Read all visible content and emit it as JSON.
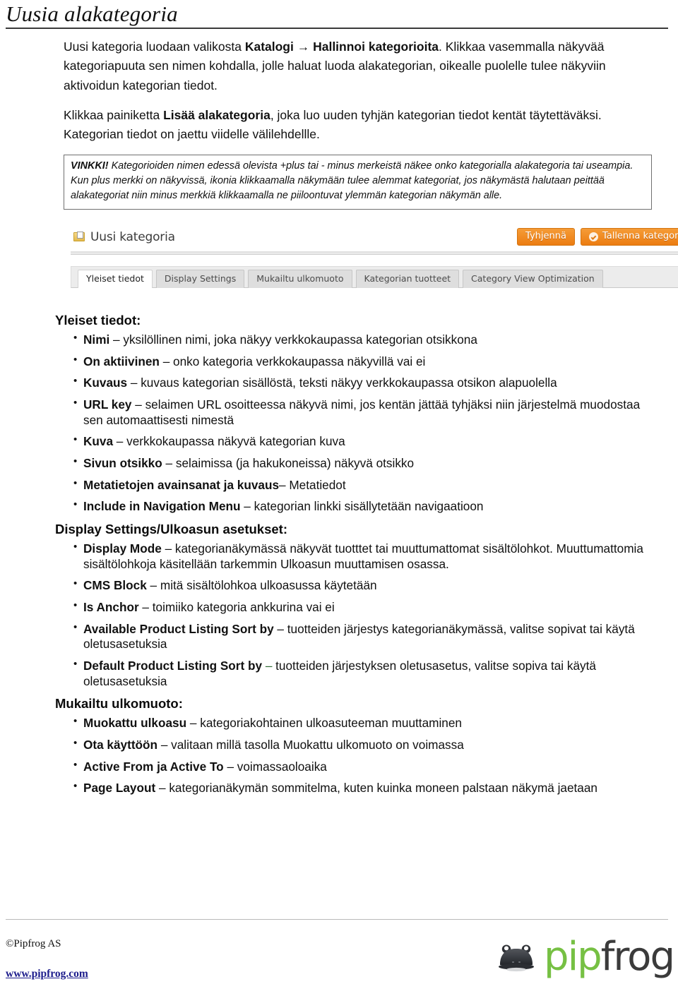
{
  "document": {
    "title": "Uusia alakategoria"
  },
  "intro": {
    "p1_a": "Uusi kategoria luodaan valikosta ",
    "p1_b": "Katalogi → Hallinnoi kategorioita",
    "p1_c": ". Klikkaa vasemmalla näkyvää kategoriapuuta sen nimen kohdalla, jolle haluat luoda alakategorian, oikealle puolelle tulee näkyviin aktivoidun kategorian tiedot.",
    "p2_a": "Klikkaa painiketta ",
    "p2_b": "Lisää alakategoria",
    "p2_c": ", joka luo uuden tyhjän kategorian tiedot kentät täytettäväksi. Kategorian tiedot on jaettu viidelle välilehdellle."
  },
  "tip": {
    "heading": "VINKKI!",
    "body": " Kategorioiden nimen edessä olevista +plus tai - minus merkeistä näkee onko kategorialla alakategoria tai useampia. Kun plus merkki on näkyvissä, ikonia klikkaamalla näkymään tulee alemmat kategoriat, jos näkymästä halutaan peittää alakategoriat niin minus merkkiä klikkaamalla ne piiloontuvat ylemmän kategorian näkymän alle."
  },
  "panel": {
    "icon": "folder-page-icon",
    "title": "Uusi kategoria",
    "buttons": [
      {
        "label": "Tyhjennä",
        "icon": null,
        "color": "#ec7c11"
      },
      {
        "label": "Tallenna kategoria",
        "icon": "check-circle-icon",
        "color": "#ec7c11"
      }
    ],
    "tabs": [
      {
        "label": "Yleiset tiedot",
        "active": true
      },
      {
        "label": "Display Settings",
        "active": false
      },
      {
        "label": "Mukailtu ulkomuoto",
        "active": false
      },
      {
        "label": "Kategorian tuotteet",
        "active": false
      },
      {
        "label": "Category View Optimization",
        "active": false
      }
    ]
  },
  "sections": [
    {
      "heading": "Yleiset tiedot:",
      "items": [
        {
          "term": "Nimi",
          "sep": " – ",
          "desc": "yksilöllinen nimi, joka näkyy verkkokaupassa kategorian otsikkona"
        },
        {
          "term": "On aktiivinen",
          "sep": " – ",
          "desc": "onko kategoria verkkokaupassa näkyvillä vai ei"
        },
        {
          "term": "Kuvaus",
          "sep": " – ",
          "desc": "kuvaus kategorian sisällöstä, teksti näkyy verkkokaupassa otsikon alapuolella"
        },
        {
          "term": "URL key",
          "sep": " – ",
          "desc": "selaimen URL osoitteessa näkyvä nimi, jos kentän jättää tyhjäksi niin järjestelmä muodostaa sen automaattisesti nimestä"
        },
        {
          "term": "Kuva",
          "sep": " – ",
          "desc": "verkkokaupassa näkyvä kategorian kuva"
        },
        {
          "term": "Sivun otsikko",
          "sep": " – ",
          "desc": "selaimissa (ja hakukoneissa) näkyvä otsikko"
        },
        {
          "term": "Metatietojen avainsanat ja kuvaus",
          "sep": "– ",
          "desc": "Metatiedot"
        },
        {
          "term": "Include in Navigation Menu",
          "sep": " – ",
          "desc": "kategorian linkki sisällytetään navigaatioon"
        }
      ]
    },
    {
      "heading": "Display Settings/Ulkoasun asetukset:",
      "items": [
        {
          "term": "Display Mode",
          "sep": " – ",
          "desc": "kategorianäkymässä näkyvät tuotttet tai muuttumattomat sisältölohkot. Muuttumattomia sisältölohkoja käsitellään tarkemmin Ulkoasun muuttamisen osassa."
        },
        {
          "term": "CMS Block",
          "sep": " – ",
          "desc": "mitä sisältölohkoa ulkoasussa käytetään"
        },
        {
          "term": "Is Anchor",
          "sep": " – ",
          "desc": "toimiiko kategoria ankkurina vai ei"
        },
        {
          "term": "Available Product Listing Sort by",
          "sep": " –  ",
          "desc": "tuotteiden järjestys kategorianäkymässä, valitse sopivat tai käytä oletusasetuksia"
        },
        {
          "term": "Default Product Listing Sort by",
          "sep": " –  ",
          "desc": "tuotteiden järjestyksen oletusasetus, valitse sopiva tai käytä oletusasetuksia",
          "sep_color": "#2f6b33"
        }
      ]
    },
    {
      "heading": "Mukailtu ulkomuoto:",
      "items": [
        {
          "term": "Muokattu ulkoasu",
          "sep": " – ",
          "desc": "kategoriakohtainen ulkoasuteeman muuttaminen"
        },
        {
          "term": "Ota käyttöön",
          "sep": "  – ",
          "desc": "valitaan millä tasolla Muokattu ulkomuoto on voimassa"
        },
        {
          "term": "Active From ja Active To",
          "sep": " – ",
          "desc": "voimassaoloaika"
        },
        {
          "term": "Page Layout",
          "sep": " – ",
          "desc": "kategorianäkymän sommitelma, kuten kuinka moneen palstaan näkymä jaetaan"
        }
      ]
    }
  ],
  "footer": {
    "copyright": "©Pipfrog AS",
    "url": "www.pipfrog.com",
    "logo": {
      "part1": "pip",
      "part2": "frog",
      "color1": "#76c043",
      "color2": "#3b3b3b"
    }
  }
}
